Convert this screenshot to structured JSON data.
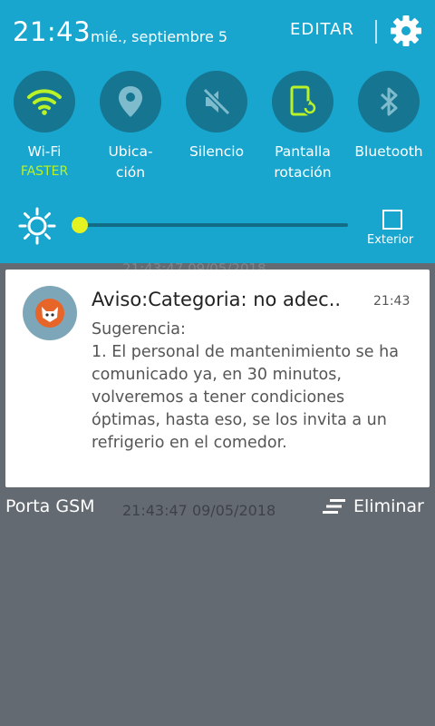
{
  "status": {
    "time": "21:43",
    "date": "mié., septiembre 5"
  },
  "header": {
    "edit_label": "EDITAR",
    "settings_icon": "gear-icon"
  },
  "tiles": [
    {
      "label": "Wi-Fi",
      "sub": "FASTER",
      "icon": "wifi-icon",
      "active": true
    },
    {
      "label": "Ubica-\nción",
      "icon": "location-icon",
      "active": false
    },
    {
      "label": "Silencio",
      "icon": "mute-icon",
      "active": false
    },
    {
      "label": "Pantalla\nrotación",
      "icon": "rotation-icon",
      "active": true
    },
    {
      "label": "Bluetooth",
      "icon": "bluetooth-icon",
      "active": false
    }
  ],
  "brightness": {
    "level": 0.02,
    "outdoor_label": "Exterior"
  },
  "background_timestamp": "21:43:47 09/05/2018",
  "notification": {
    "title": "Aviso:Categoria: no adec..",
    "time": "21:43",
    "body": "Sugerencia:\n1. El personal de mantenimiento se ha comunicado ya, en 30 minutos, volveremos a tener condiciones óptimas, hasta eso, se los invita a un refrigerio en el comedor."
  },
  "footer": {
    "carrier": "Porta GSM",
    "timestamp": "21:43:47 09/05/2018",
    "clear_label": "Eliminar"
  },
  "colors": {
    "panel": "#18a6cf",
    "tile_bg": "#167590",
    "accent": "#b9f227",
    "background": "#646a71"
  }
}
